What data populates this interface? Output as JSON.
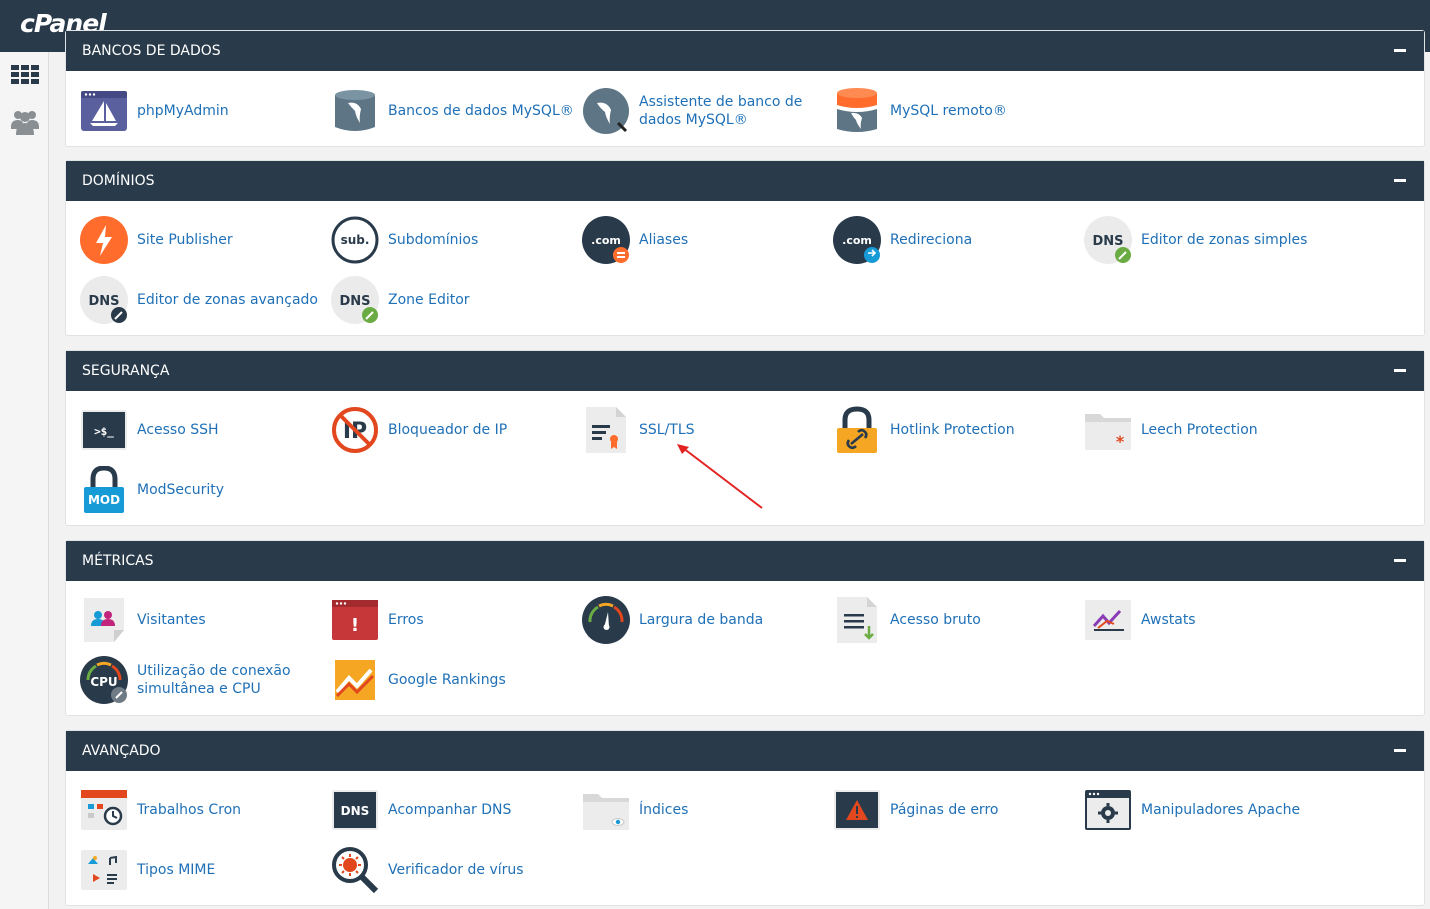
{
  "header": {
    "logo": "cPanel"
  },
  "sidebar": {
    "items": [
      {
        "icon": "grid-icon"
      },
      {
        "icon": "users-icon"
      }
    ]
  },
  "groups": {
    "databases": {
      "title": "Bancos de dados",
      "items": [
        {
          "label": "phpMyAdmin",
          "icon": "phpmyadmin-icon"
        },
        {
          "label": "Bancos de dados MySQL®",
          "icon": "mysql-icon"
        },
        {
          "label": "Assistente de banco de dados MySQL®",
          "icon": "mysql-wizard-icon"
        },
        {
          "label": "MySQL remoto®",
          "icon": "remote-mysql-icon"
        }
      ]
    },
    "domains": {
      "title": "Domínios",
      "items": [
        {
          "label": "Site Publisher",
          "icon": "lightning-icon"
        },
        {
          "label": "Subdomínios",
          "icon": "sub-icon",
          "badge": "sub."
        },
        {
          "label": "Aliases",
          "icon": "dotcom-icon",
          "badge": ".com"
        },
        {
          "label": "Redireciona",
          "icon": "dotcom-redirect-icon",
          "badge": ".com"
        },
        {
          "label": "Editor de zonas simples",
          "icon": "dns-icon",
          "badge": "DNS"
        },
        {
          "label": "Editor de zonas avançado",
          "icon": "dns-edit-icon",
          "badge": "DNS"
        },
        {
          "label": "Zone Editor",
          "icon": "dns-zone-icon",
          "badge": "DNS"
        }
      ]
    },
    "security": {
      "title": "Segurança",
      "items": [
        {
          "label": "Acesso SSH",
          "icon": "terminal-icon",
          "badge": ">$_"
        },
        {
          "label": "Bloqueador de IP",
          "icon": "ip-block-icon",
          "badge": "IP"
        },
        {
          "label": "SSL/TLS",
          "icon": "certificate-icon"
        },
        {
          "label": "Hotlink Protection",
          "icon": "hotlink-lock-icon"
        },
        {
          "label": "Leech Protection",
          "icon": "leech-folder-icon"
        },
        {
          "label": "ModSecurity",
          "icon": "modsecurity-lock-icon",
          "badge": "MOD"
        }
      ]
    },
    "metrics": {
      "title": "Métricas",
      "items": [
        {
          "label": "Visitantes",
          "icon": "visitors-icon"
        },
        {
          "label": "Erros",
          "icon": "errors-icon",
          "badge": "!"
        },
        {
          "label": "Largura de banda",
          "icon": "bandwidth-gauge-icon"
        },
        {
          "label": "Acesso bruto",
          "icon": "raw-access-icon"
        },
        {
          "label": "Awstats",
          "icon": "awstats-icon"
        },
        {
          "label": "Utilização de conexão simultânea e CPU",
          "icon": "cpu-icon",
          "badge": "CPU"
        },
        {
          "label": "Google Rankings",
          "icon": "rankings-icon"
        }
      ]
    },
    "advanced": {
      "title": "Avançado",
      "items": [
        {
          "label": "Trabalhos Cron",
          "icon": "cron-calendar-icon"
        },
        {
          "label": "Acompanhar DNS",
          "icon": "track-dns-icon",
          "badge": "DNS"
        },
        {
          "label": "Índices",
          "icon": "indexes-folder-icon"
        },
        {
          "label": "Páginas de erro",
          "icon": "error-pages-icon"
        },
        {
          "label": "Manipuladores Apache",
          "icon": "apache-handlers-icon"
        },
        {
          "label": "Tipos MIME",
          "icon": "mime-types-icon"
        },
        {
          "label": "Verificador de vírus",
          "icon": "virus-scanner-icon"
        }
      ]
    }
  },
  "colors": {
    "header": "#293a4a",
    "link": "#1f70b7",
    "accent": "#ff6c2c"
  }
}
